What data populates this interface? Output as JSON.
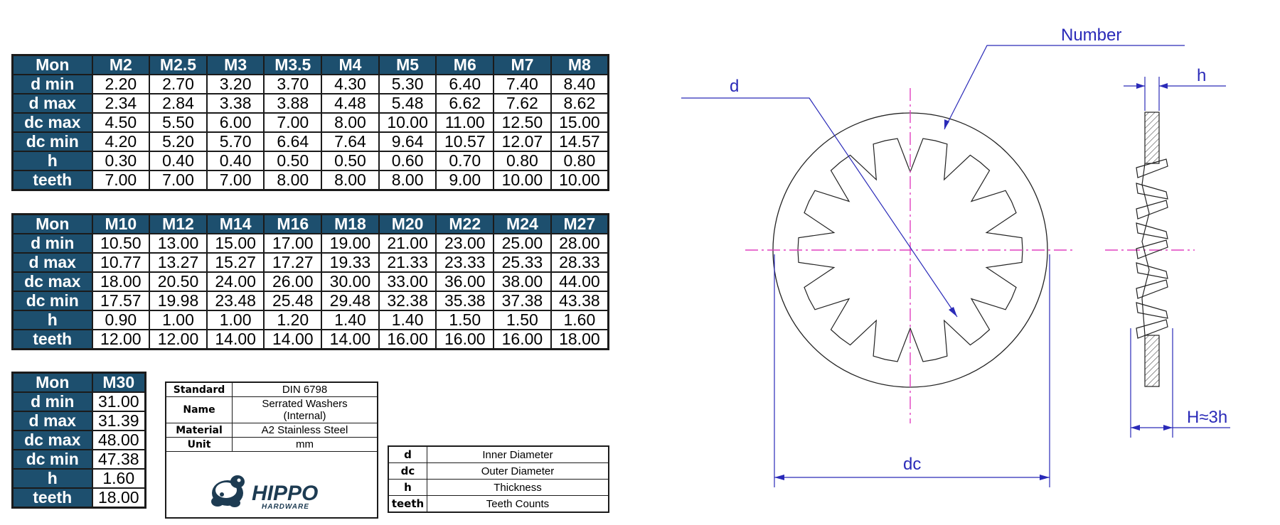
{
  "table_a": {
    "columns": [
      "Mon",
      "M2",
      "M2.5",
      "M3",
      "M3.5",
      "M4",
      "M5",
      "M6",
      "M7",
      "M8"
    ],
    "rows": [
      {
        "label": "d min",
        "values": [
          "2.20",
          "2.70",
          "3.20",
          "3.70",
          "4.30",
          "5.30",
          "6.40",
          "7.40",
          "8.40"
        ]
      },
      {
        "label": "d max",
        "values": [
          "2.34",
          "2.84",
          "3.38",
          "3.88",
          "4.48",
          "5.48",
          "6.62",
          "7.62",
          "8.62"
        ]
      },
      {
        "label": "dc max",
        "values": [
          "4.50",
          "5.50",
          "6.00",
          "7.00",
          "8.00",
          "10.00",
          "11.00",
          "12.50",
          "15.00"
        ]
      },
      {
        "label": "dc min",
        "values": [
          "4.20",
          "5.20",
          "5.70",
          "6.64",
          "7.64",
          "9.64",
          "10.57",
          "12.07",
          "14.57"
        ]
      },
      {
        "label": "h",
        "values": [
          "0.30",
          "0.40",
          "0.40",
          "0.50",
          "0.50",
          "0.60",
          "0.70",
          "0.80",
          "0.80"
        ]
      },
      {
        "label": "teeth",
        "values": [
          "7.00",
          "7.00",
          "7.00",
          "8.00",
          "8.00",
          "8.00",
          "9.00",
          "10.00",
          "10.00"
        ]
      }
    ]
  },
  "table_b": {
    "columns": [
      "Mon",
      "M10",
      "M12",
      "M14",
      "M16",
      "M18",
      "M20",
      "M22",
      "M24",
      "M27"
    ],
    "rows": [
      {
        "label": "d min",
        "values": [
          "10.50",
          "13.00",
          "15.00",
          "17.00",
          "19.00",
          "21.00",
          "23.00",
          "25.00",
          "28.00"
        ]
      },
      {
        "label": "d max",
        "values": [
          "10.77",
          "13.27",
          "15.27",
          "17.27",
          "19.33",
          "21.33",
          "23.33",
          "25.33",
          "28.33"
        ]
      },
      {
        "label": "dc max",
        "values": [
          "18.00",
          "20.50",
          "24.00",
          "26.00",
          "30.00",
          "33.00",
          "36.00",
          "38.00",
          "44.00"
        ]
      },
      {
        "label": "dc min",
        "values": [
          "17.57",
          "19.98",
          "23.48",
          "25.48",
          "29.48",
          "32.38",
          "35.38",
          "37.38",
          "43.38"
        ]
      },
      {
        "label": "h",
        "values": [
          "0.90",
          "1.00",
          "1.00",
          "1.20",
          "1.40",
          "1.40",
          "1.50",
          "1.50",
          "1.60"
        ]
      },
      {
        "label": "teeth",
        "values": [
          "12.00",
          "12.00",
          "14.00",
          "14.00",
          "14.00",
          "16.00",
          "16.00",
          "16.00",
          "18.00"
        ]
      }
    ]
  },
  "table_c": {
    "columns": [
      "Mon",
      "M30"
    ],
    "rows": [
      {
        "label": "d min",
        "values": [
          "31.00"
        ]
      },
      {
        "label": "d max",
        "values": [
          "31.39"
        ]
      },
      {
        "label": "dc max",
        "values": [
          "48.00"
        ]
      },
      {
        "label": "dc min",
        "values": [
          "47.38"
        ]
      },
      {
        "label": "h",
        "values": [
          "1.60"
        ]
      },
      {
        "label": "teeth",
        "values": [
          "18.00"
        ]
      }
    ]
  },
  "info": {
    "standard_label": "Standard",
    "standard": "DIN 6798",
    "name_label": "Name",
    "name_line1": "Serrated Washers",
    "name_line2": "(Internal)",
    "material_label": "Material",
    "material": "A2 Stainless Steel",
    "unit_label": "Unit",
    "unit": "mm",
    "logo_text": "HIPPO",
    "logo_sub": "HARDWARE"
  },
  "legend": [
    {
      "key": "d",
      "desc": "Inner Diameter"
    },
    {
      "key": "dc",
      "desc": "Outer Diameter"
    },
    {
      "key": "h",
      "desc": "Thickness"
    },
    {
      "key": "teeth",
      "desc": "Teeth Counts"
    }
  ],
  "drawing": {
    "label_number": "Number",
    "label_d": "d",
    "label_dc": "dc",
    "label_h": "h",
    "label_H": "H≈3h",
    "dim_color": "#2a2ab8",
    "center_color": "#e040c0",
    "tooth_count": 14
  }
}
